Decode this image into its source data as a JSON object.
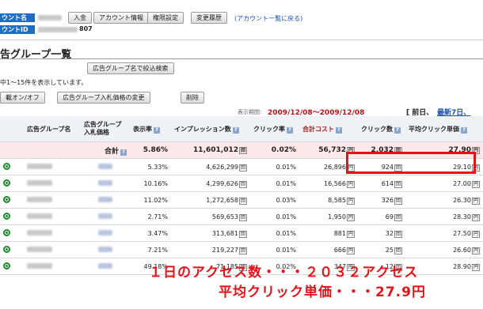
{
  "account": {
    "name_label": "ウント名",
    "id_label": "ウントID",
    "id_suffix": "807",
    "buttons": [
      "入金",
      "アカウント情報",
      "権限設定",
      "変更履歴"
    ],
    "back_link": "(アカウント一覧に戻る)"
  },
  "page": {
    "title": "告グループ一覧",
    "filter_button": "広告グループ名で絞込検索",
    "range_text": "中1～15件を表示しています。",
    "actions": [
      "載オン/オフ",
      "広告グループ入札価格の変更",
      "削除"
    ]
  },
  "period": {
    "label": "表示期間:",
    "range": "2009/12/08～2009/12/08",
    "prev": "[ 前日、",
    "latest": "最新7日、"
  },
  "table": {
    "headers": [
      "広告グループ名",
      "広告グループ入札価格",
      "表示率",
      "インプレッション数",
      "クリック率",
      "合計コスト",
      "クリック数",
      "平均クリック単価"
    ],
    "total": {
      "label": "合計",
      "rate": "5.86%",
      "impressions": "11,601,012",
      "ctr": "0.02%",
      "cost": "56,732",
      "clicks": "2,032",
      "cpc": "27.90"
    },
    "rows": [
      {
        "rate": "5.33%",
        "impressions": "4,626,299",
        "ctr": "0.01%",
        "cost": "26,896",
        "clicks": "924",
        "cpc": "29.10"
      },
      {
        "rate": "10.16%",
        "impressions": "4,299,626",
        "ctr": "0.01%",
        "cost": "16,566",
        "clicks": "614",
        "cpc": "27.00"
      },
      {
        "rate": "11.02%",
        "impressions": "1,272,658",
        "ctr": "0.03%",
        "cost": "8,585",
        "clicks": "326",
        "cpc": "26.30"
      },
      {
        "rate": "2.71%",
        "impressions": "569,653",
        "ctr": "0.01%",
        "cost": "1,950",
        "clicks": "69",
        "cpc": "28.30"
      },
      {
        "rate": "3.47%",
        "impressions": "313,681",
        "ctr": "0.01%",
        "cost": "881",
        "clicks": "32",
        "cpc": "27.50"
      },
      {
        "rate": "7.21%",
        "impressions": "219,227",
        "ctr": "0.01%",
        "cost": "666",
        "clicks": "25",
        "cpc": "26.60"
      },
      {
        "rate": "49.18%",
        "impressions": "71,185",
        "ctr": "0.02%",
        "cost": "347",
        "clicks": "12",
        "cpc": "28.90"
      }
    ]
  },
  "annotation": {
    "line1": "１日のアクセス数・・・２０３２アクセス",
    "line2": "平均クリック単価・・・27.9円"
  },
  "colors": {
    "accent": "#1e6fc2",
    "highlight": "#e5121a",
    "total_row": "#fde8ea",
    "status_green": "#1a8a2a"
  }
}
